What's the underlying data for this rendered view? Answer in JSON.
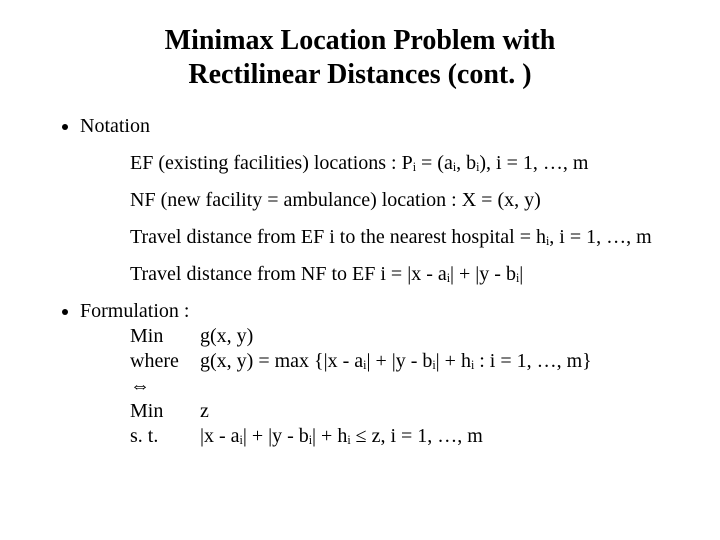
{
  "title_line1": "Minimax Location Problem with",
  "title_line2": "Rectilinear Distances (cont. )",
  "bullets": {
    "notation_label": "Notation",
    "formulation_label": "Formulation :"
  },
  "notation": {
    "ef": "EF (existing facilities) locations : Pᵢ = (aᵢ, bᵢ), i = 1, …, m",
    "nf": "NF (new facility = ambulance) location : X = (x, y)",
    "hi": "Travel distance from EF i to the nearest hospital = hᵢ,  i = 1, …, m",
    "dist": "Travel distance from NF to EF i = |x - aᵢ| + |y - bᵢ|"
  },
  "formulation": {
    "min1": "Min",
    "g1": "g(x, y)",
    "where": "where",
    "gdef": "g(x, y)   = max {|x - aᵢ| + |y - bᵢ| + hᵢ : i = 1, …, m}",
    "equiv": "⇔",
    "min2": "Min",
    "z": "z",
    "st": "s. t.",
    "constraint": "|x - aᵢ| + |y - bᵢ| + hᵢ ≤ z,       i = 1, …, m"
  }
}
